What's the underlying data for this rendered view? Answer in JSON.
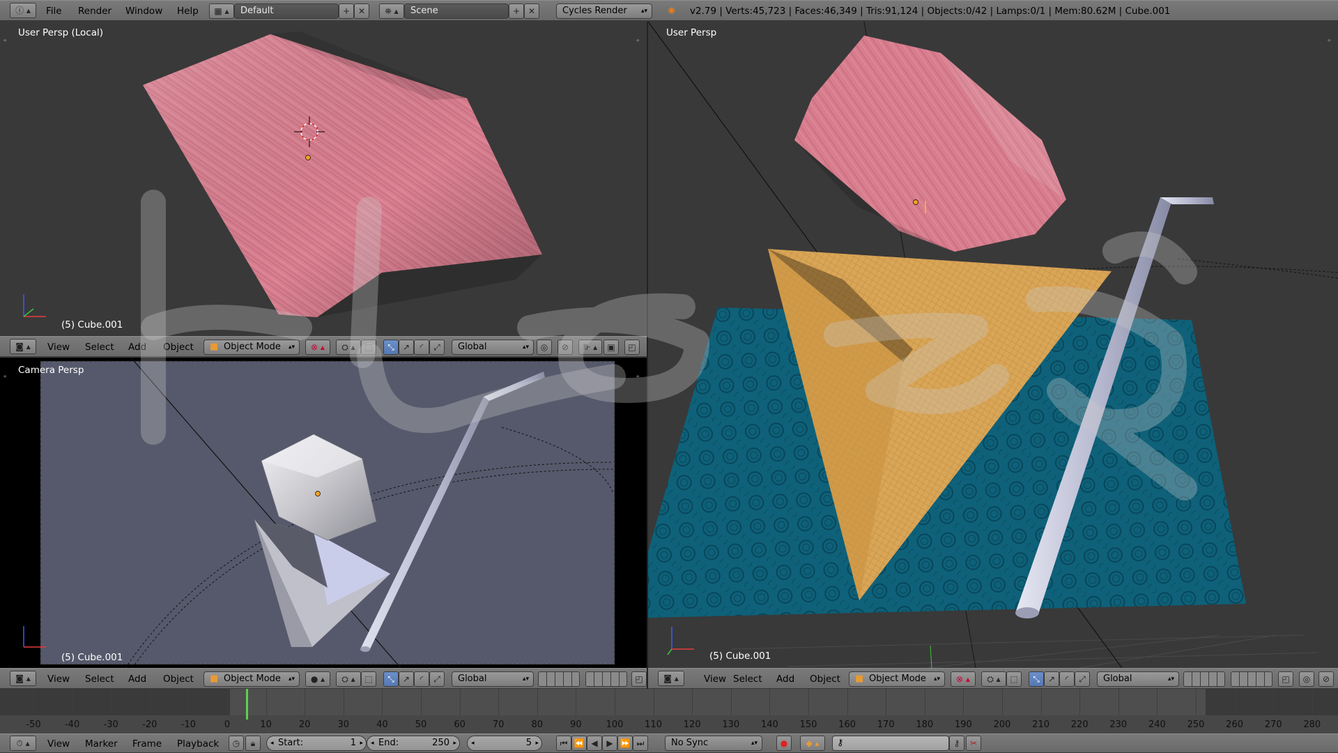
{
  "topbar": {
    "menus": [
      "File",
      "Render",
      "Window",
      "Help"
    ],
    "layout": "Default",
    "scene": "Scene",
    "engine": "Cycles Render",
    "stats": "v2.79 | Verts:45,723 | Faces:46,349 | Tris:91,124 | Objects:0/42 | Lamps:0/1 | Mem:80.62M | Cube.001"
  },
  "viewports": {
    "top_left": {
      "label": "User Persp (Local)",
      "object": "(5) Cube.001"
    },
    "bottom_left": {
      "label": "Camera Persp",
      "object": "(5) Cube.001"
    },
    "right": {
      "label": "User Persp",
      "object": "(5) Cube.001"
    }
  },
  "view_header": {
    "menus": [
      "View",
      "Select",
      "Add",
      "Object"
    ],
    "mode": "Object Mode",
    "orientation": "Global"
  },
  "timeline": {
    "ticks": [
      "-50",
      "-40",
      "-30",
      "-20",
      "-10",
      "0",
      "10",
      "20",
      "30",
      "40",
      "50",
      "60",
      "70",
      "80",
      "90",
      "100",
      "110",
      "120",
      "130",
      "140",
      "150",
      "160",
      "170",
      "180",
      "190",
      "200",
      "210",
      "220",
      "230",
      "240",
      "250",
      "260",
      "270",
      "280"
    ],
    "menus": [
      "View",
      "Marker",
      "Frame",
      "Playback"
    ],
    "start_label": "Start:",
    "start_value": "1",
    "end_label": "End:",
    "end_value": "250",
    "current_frame": "5",
    "sync": "No Sync"
  },
  "colors": {
    "viewport_bg": "#393939",
    "header_bg": "#727272",
    "camera_bg": "#56596b",
    "blue_plane": "#0f5f7a",
    "orange": "#d9a556",
    "pink": "#d77d8e"
  }
}
